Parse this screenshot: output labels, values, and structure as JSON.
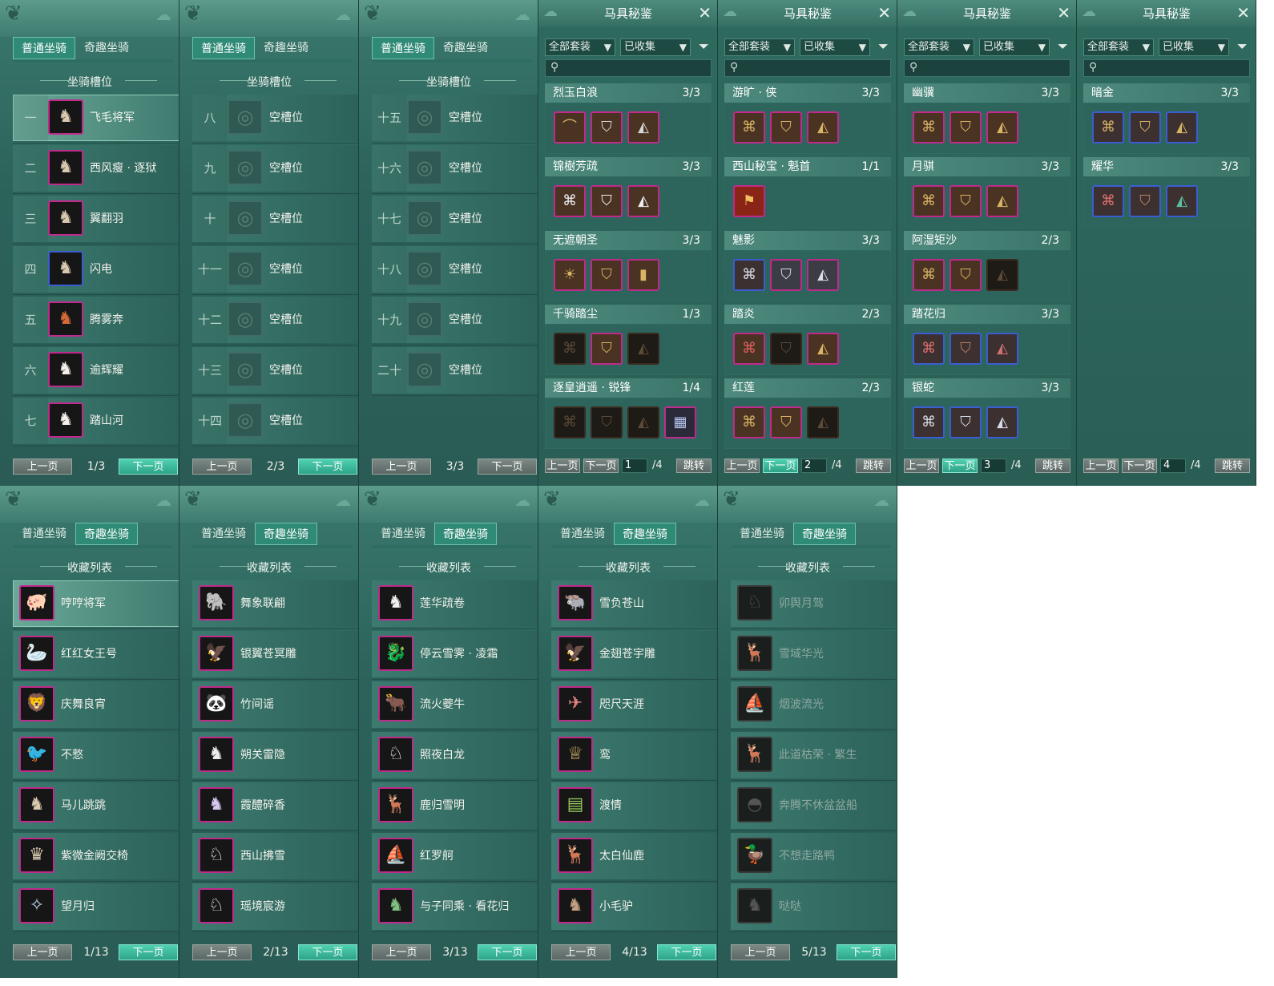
{
  "common": {
    "tab_normal": "普通坐骑",
    "tab_fun": "奇趣坐骑",
    "prev": "上一页",
    "next": "下一页",
    "slots_title": "坐骑槽位",
    "collection_title": "收藏列表",
    "book_title": "马具秘鉴",
    "dd_all_sets": "全部套装",
    "dd_collected": "已收集",
    "jump": "跳转",
    "empty_slot": "空槽位"
  },
  "slot_panels": [
    {
      "page": "1/3",
      "slots": [
        {
          "idx": "一",
          "name": "飞毛将军",
          "selected": true
        },
        {
          "idx": "二",
          "name": "西风瘦 · 逐狱"
        },
        {
          "idx": "三",
          "name": "翼翻羽"
        },
        {
          "idx": "四",
          "name": "闪电"
        },
        {
          "idx": "五",
          "name": "腾雾奔"
        },
        {
          "idx": "六",
          "name": "逾辉耀"
        },
        {
          "idx": "七",
          "name": "踏山河"
        }
      ]
    },
    {
      "page": "2/3",
      "slots": [
        {
          "idx": "八",
          "name": "空槽位"
        },
        {
          "idx": "九",
          "name": "空槽位"
        },
        {
          "idx": "十",
          "name": "空槽位"
        },
        {
          "idx": "十一",
          "name": "空槽位"
        },
        {
          "idx": "十二",
          "name": "空槽位"
        },
        {
          "idx": "十三",
          "name": "空槽位"
        },
        {
          "idx": "十四",
          "name": "空槽位"
        }
      ]
    },
    {
      "page": "3/3",
      "slots": [
        {
          "idx": "十五",
          "name": "空槽位"
        },
        {
          "idx": "十六",
          "name": "空槽位"
        },
        {
          "idx": "十七",
          "name": "空槽位"
        },
        {
          "idx": "十八",
          "name": "空槽位"
        },
        {
          "idx": "十九",
          "name": "空槽位"
        },
        {
          "idx": "二十",
          "name": "空槽位"
        }
      ]
    }
  ],
  "books": [
    {
      "page": "1",
      "total": "/4",
      "sets": [
        {
          "name": "烈玉白浪",
          "count": "3/3"
        },
        {
          "name": "锦樹芳疏",
          "count": "3/3"
        },
        {
          "name": "无遮朝圣",
          "count": "3/3"
        },
        {
          "name": "千骑踏尘",
          "count": "1/3"
        },
        {
          "name": "逐皇逍遥 · 锐锋",
          "count": "1/4"
        }
      ]
    },
    {
      "page": "2",
      "total": "/4",
      "sets": [
        {
          "name": "游旷 · 侠",
          "count": "3/3"
        },
        {
          "name": "西山秘宝 · 魁首",
          "count": "1/1"
        },
        {
          "name": "魅影",
          "count": "3/3"
        },
        {
          "name": "踏炎",
          "count": "2/3"
        },
        {
          "name": "红莲",
          "count": "2/3"
        }
      ]
    },
    {
      "page": "3",
      "total": "/4",
      "sets": [
        {
          "name": "幽骥",
          "count": "3/3"
        },
        {
          "name": "月骐",
          "count": "3/3"
        },
        {
          "name": "阿湿矩沙",
          "count": "2/3"
        },
        {
          "name": "踏花归",
          "count": "3/3"
        },
        {
          "name": "银蛇",
          "count": "3/3"
        }
      ]
    },
    {
      "page": "4",
      "total": "/4",
      "sets": [
        {
          "name": "暗金",
          "count": "3/3"
        },
        {
          "name": "耀华",
          "count": "3/3"
        }
      ]
    }
  ],
  "collection_panels": [
    {
      "page": "1/13",
      "items": [
        "哼哼将军",
        "红红女王号",
        "庆舞良宵",
        "不憗",
        "马儿跳跳",
        "紫微金阙交椅",
        "望月归"
      ]
    },
    {
      "page": "2/13",
      "items": [
        "舞象联翩",
        "银翼苍冥雕",
        "竹间谣",
        "朔关雷隐",
        "霞醴碎香",
        "西山拂雪",
        "瑶境宸游"
      ]
    },
    {
      "page": "3/13",
      "items": [
        "莲华疏卷",
        "停云雪霁 · 凌霜",
        "流火夔牛",
        "照夜白龙",
        "鹿归雪明",
        "红罗舸",
        "与子同乘 · 看花归"
      ]
    },
    {
      "page": "4/13",
      "items": [
        "雪负苍山",
        "金翅苍宇雕",
        "咫尺天涯",
        "鸾",
        "渡情",
        "太白仙鹿",
        "小毛驴"
      ]
    },
    {
      "page": "5/13",
      "items": [
        "卯舆月驾",
        "雪域华光",
        "烟波流光",
        "此道枯荣 · 繁生",
        "奔腾不休盆盆船",
        "不想走路鸭",
        "哒哒"
      ]
    }
  ]
}
